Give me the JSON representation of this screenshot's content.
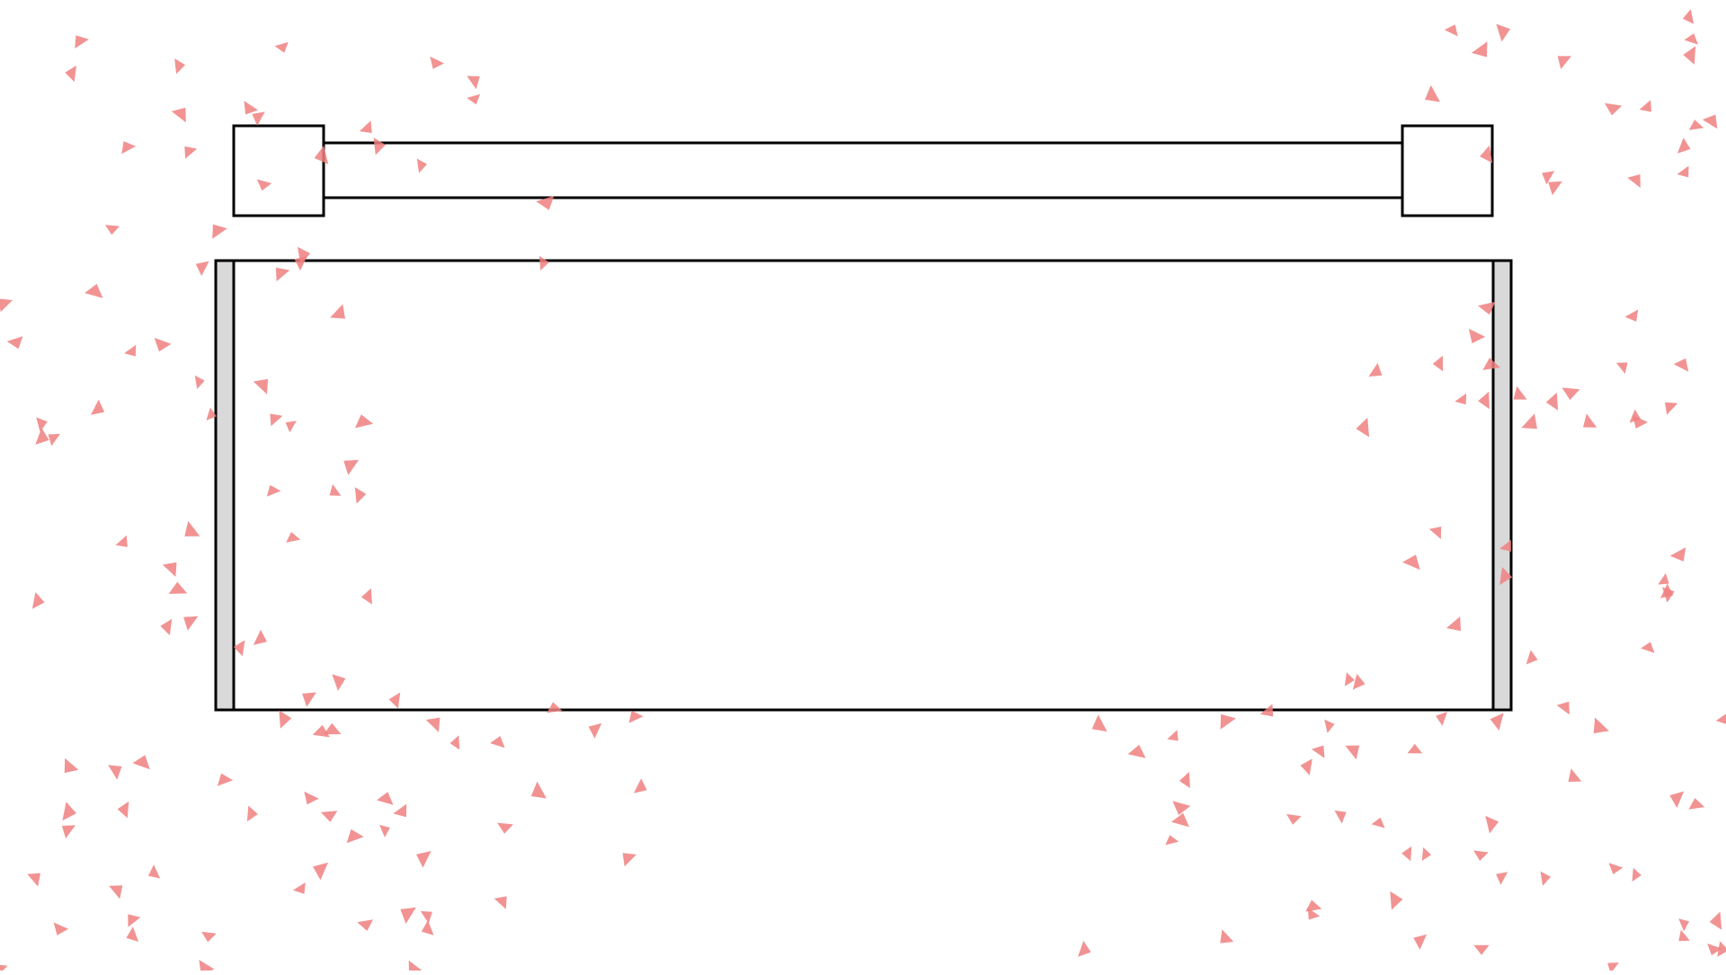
{
  "scene": {
    "background": "#ffffff",
    "stroke_color": "#000000",
    "wall_fill": "#d9d9d9",
    "particle_color": "#f08080"
  },
  "objects": [
    {
      "id": "top-left-anchor-block",
      "kind": "block"
    },
    {
      "id": "top-connector-bar",
      "kind": "bar"
    },
    {
      "id": "top-right-anchor-block",
      "kind": "block"
    },
    {
      "id": "arena-container",
      "kind": "container"
    },
    {
      "id": "left-wall",
      "kind": "wall"
    },
    {
      "id": "right-wall",
      "kind": "wall"
    }
  ],
  "particles": {
    "shape": "triangle",
    "description_count": 200
  }
}
